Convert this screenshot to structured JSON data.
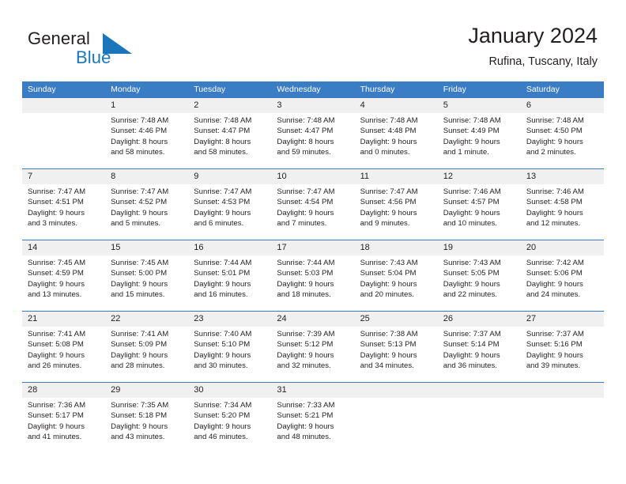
{
  "brand": {
    "line1": "General",
    "line2": "Blue",
    "mark_icon": "triangle-logo-icon"
  },
  "header": {
    "title": "January 2024",
    "subtitle": "Rufina, Tuscany, Italy"
  },
  "colors": {
    "header_blue": "#3b7dc4",
    "brand_blue": "#1b75bb",
    "day_number_bg": "#f0f0f0",
    "text": "#231f20"
  },
  "weekday_headers": [
    "Sunday",
    "Monday",
    "Tuesday",
    "Wednesday",
    "Thursday",
    "Friday",
    "Saturday"
  ],
  "labels": {
    "sunrise_prefix": "Sunrise:",
    "sunset_prefix": "Sunset:",
    "daylight_prefix": "Daylight:"
  },
  "weeks": [
    [
      {
        "day": "",
        "l1": "",
        "l2": "",
        "l3": "",
        "l4": ""
      },
      {
        "day": "1",
        "l1": "Sunrise: 7:48 AM",
        "l2": "Sunset: 4:46 PM",
        "l3": "Daylight: 8 hours",
        "l4": "and 58 minutes."
      },
      {
        "day": "2",
        "l1": "Sunrise: 7:48 AM",
        "l2": "Sunset: 4:47 PM",
        "l3": "Daylight: 8 hours",
        "l4": "and 58 minutes."
      },
      {
        "day": "3",
        "l1": "Sunrise: 7:48 AM",
        "l2": "Sunset: 4:47 PM",
        "l3": "Daylight: 8 hours",
        "l4": "and 59 minutes."
      },
      {
        "day": "4",
        "l1": "Sunrise: 7:48 AM",
        "l2": "Sunset: 4:48 PM",
        "l3": "Daylight: 9 hours",
        "l4": "and 0 minutes."
      },
      {
        "day": "5",
        "l1": "Sunrise: 7:48 AM",
        "l2": "Sunset: 4:49 PM",
        "l3": "Daylight: 9 hours",
        "l4": "and 1 minute."
      },
      {
        "day": "6",
        "l1": "Sunrise: 7:48 AM",
        "l2": "Sunset: 4:50 PM",
        "l3": "Daylight: 9 hours",
        "l4": "and 2 minutes."
      }
    ],
    [
      {
        "day": "7",
        "l1": "Sunrise: 7:47 AM",
        "l2": "Sunset: 4:51 PM",
        "l3": "Daylight: 9 hours",
        "l4": "and 3 minutes."
      },
      {
        "day": "8",
        "l1": "Sunrise: 7:47 AM",
        "l2": "Sunset: 4:52 PM",
        "l3": "Daylight: 9 hours",
        "l4": "and 5 minutes."
      },
      {
        "day": "9",
        "l1": "Sunrise: 7:47 AM",
        "l2": "Sunset: 4:53 PM",
        "l3": "Daylight: 9 hours",
        "l4": "and 6 minutes."
      },
      {
        "day": "10",
        "l1": "Sunrise: 7:47 AM",
        "l2": "Sunset: 4:54 PM",
        "l3": "Daylight: 9 hours",
        "l4": "and 7 minutes."
      },
      {
        "day": "11",
        "l1": "Sunrise: 7:47 AM",
        "l2": "Sunset: 4:56 PM",
        "l3": "Daylight: 9 hours",
        "l4": "and 9 minutes."
      },
      {
        "day": "12",
        "l1": "Sunrise: 7:46 AM",
        "l2": "Sunset: 4:57 PM",
        "l3": "Daylight: 9 hours",
        "l4": "and 10 minutes."
      },
      {
        "day": "13",
        "l1": "Sunrise: 7:46 AM",
        "l2": "Sunset: 4:58 PM",
        "l3": "Daylight: 9 hours",
        "l4": "and 12 minutes."
      }
    ],
    [
      {
        "day": "14",
        "l1": "Sunrise: 7:45 AM",
        "l2": "Sunset: 4:59 PM",
        "l3": "Daylight: 9 hours",
        "l4": "and 13 minutes."
      },
      {
        "day": "15",
        "l1": "Sunrise: 7:45 AM",
        "l2": "Sunset: 5:00 PM",
        "l3": "Daylight: 9 hours",
        "l4": "and 15 minutes."
      },
      {
        "day": "16",
        "l1": "Sunrise: 7:44 AM",
        "l2": "Sunset: 5:01 PM",
        "l3": "Daylight: 9 hours",
        "l4": "and 16 minutes."
      },
      {
        "day": "17",
        "l1": "Sunrise: 7:44 AM",
        "l2": "Sunset: 5:03 PM",
        "l3": "Daylight: 9 hours",
        "l4": "and 18 minutes."
      },
      {
        "day": "18",
        "l1": "Sunrise: 7:43 AM",
        "l2": "Sunset: 5:04 PM",
        "l3": "Daylight: 9 hours",
        "l4": "and 20 minutes."
      },
      {
        "day": "19",
        "l1": "Sunrise: 7:43 AM",
        "l2": "Sunset: 5:05 PM",
        "l3": "Daylight: 9 hours",
        "l4": "and 22 minutes."
      },
      {
        "day": "20",
        "l1": "Sunrise: 7:42 AM",
        "l2": "Sunset: 5:06 PM",
        "l3": "Daylight: 9 hours",
        "l4": "and 24 minutes."
      }
    ],
    [
      {
        "day": "21",
        "l1": "Sunrise: 7:41 AM",
        "l2": "Sunset: 5:08 PM",
        "l3": "Daylight: 9 hours",
        "l4": "and 26 minutes."
      },
      {
        "day": "22",
        "l1": "Sunrise: 7:41 AM",
        "l2": "Sunset: 5:09 PM",
        "l3": "Daylight: 9 hours",
        "l4": "and 28 minutes."
      },
      {
        "day": "23",
        "l1": "Sunrise: 7:40 AM",
        "l2": "Sunset: 5:10 PM",
        "l3": "Daylight: 9 hours",
        "l4": "and 30 minutes."
      },
      {
        "day": "24",
        "l1": "Sunrise: 7:39 AM",
        "l2": "Sunset: 5:12 PM",
        "l3": "Daylight: 9 hours",
        "l4": "and 32 minutes."
      },
      {
        "day": "25",
        "l1": "Sunrise: 7:38 AM",
        "l2": "Sunset: 5:13 PM",
        "l3": "Daylight: 9 hours",
        "l4": "and 34 minutes."
      },
      {
        "day": "26",
        "l1": "Sunrise: 7:37 AM",
        "l2": "Sunset: 5:14 PM",
        "l3": "Daylight: 9 hours",
        "l4": "and 36 minutes."
      },
      {
        "day": "27",
        "l1": "Sunrise: 7:37 AM",
        "l2": "Sunset: 5:16 PM",
        "l3": "Daylight: 9 hours",
        "l4": "and 39 minutes."
      }
    ],
    [
      {
        "day": "28",
        "l1": "Sunrise: 7:36 AM",
        "l2": "Sunset: 5:17 PM",
        "l3": "Daylight: 9 hours",
        "l4": "and 41 minutes."
      },
      {
        "day": "29",
        "l1": "Sunrise: 7:35 AM",
        "l2": "Sunset: 5:18 PM",
        "l3": "Daylight: 9 hours",
        "l4": "and 43 minutes."
      },
      {
        "day": "30",
        "l1": "Sunrise: 7:34 AM",
        "l2": "Sunset: 5:20 PM",
        "l3": "Daylight: 9 hours",
        "l4": "and 46 minutes."
      },
      {
        "day": "31",
        "l1": "Sunrise: 7:33 AM",
        "l2": "Sunset: 5:21 PM",
        "l3": "Daylight: 9 hours",
        "l4": "and 48 minutes."
      },
      {
        "day": "",
        "l1": "",
        "l2": "",
        "l3": "",
        "l4": ""
      },
      {
        "day": "",
        "l1": "",
        "l2": "",
        "l3": "",
        "l4": ""
      },
      {
        "day": "",
        "l1": "",
        "l2": "",
        "l3": "",
        "l4": ""
      }
    ]
  ]
}
